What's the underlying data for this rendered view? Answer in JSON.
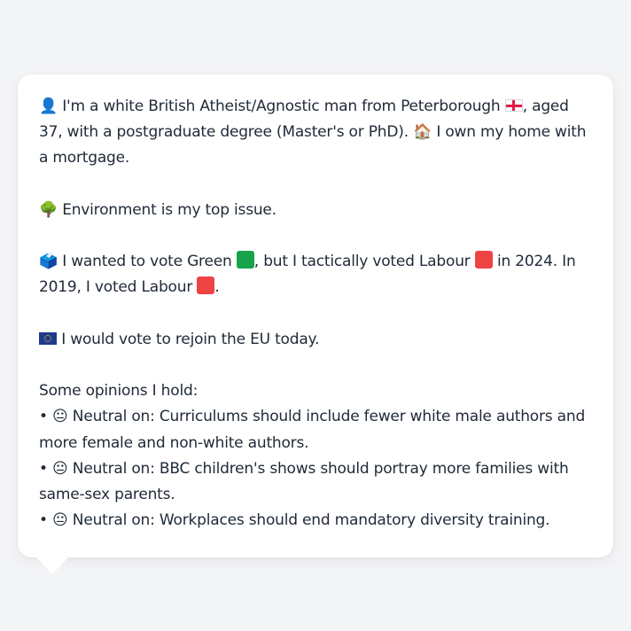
{
  "profile": {
    "intro": {
      "person_icon": "👤",
      "text_1": "I'm a white British Atheist/Agnostic man from Peterborough",
      "text_2": ", aged 37, with a postgraduate degree (Master's or PhD).",
      "house_icon": "🏠",
      "text_3": "I own my home with a mortgage."
    },
    "issue": {
      "icon": "🌳",
      "text": "Environment is my top issue."
    },
    "vote": {
      "icon": "🗳️",
      "text_1": "I wanted to vote Green",
      "text_2": ", but I tactically voted Labour",
      "text_3": "in 2024. In 2019, I voted Labour",
      "text_4": "."
    },
    "eu": {
      "text": "I would vote to rejoin the EU today."
    },
    "opinions": {
      "heading": "Some opinions I hold:",
      "items": [
        {
          "bullet": "•",
          "icon": "😐",
          "label": "Neutral on:",
          "text": "Curriculums should include fewer white male authors and more female and non-white authors."
        },
        {
          "bullet": "•",
          "icon": "😐",
          "label": "Neutral on:",
          "text": "BBC children's shows should portray more families with same-sex parents."
        },
        {
          "bullet": "•",
          "icon": "😐",
          "label": "Neutral on:",
          "text": "Workplaces should end mandatory diversity training."
        }
      ]
    }
  },
  "colors": {
    "green_party": "#16a34a",
    "labour": "#ef4444",
    "background": "#f3f4f6",
    "bubble": "#ffffff"
  }
}
